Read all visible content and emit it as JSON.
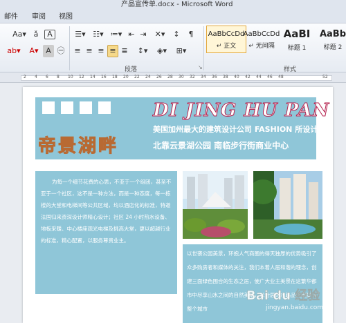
{
  "window": {
    "title": "产品宣传单.docx - Microsoft Word"
  },
  "tabs": [
    {
      "label": "邮件"
    },
    {
      "label": "审阅"
    },
    {
      "label": "视图"
    }
  ],
  "ribbon": {
    "font_size_grow": "Aa",
    "font_color_label": "A",
    "paragraph_group": "段落",
    "styles_group": "样式",
    "styles": [
      {
        "sample": "AaBbCcDd",
        "name": "正文",
        "active": true
      },
      {
        "sample": "AaBbCcDd",
        "name": "无间隔",
        "active": false
      },
      {
        "sample": "AaBI",
        "name": "标题 1",
        "active": false
      },
      {
        "sample": "AaBb",
        "name": "标题 2",
        "active": false
      }
    ]
  },
  "ruler": {
    "numbers": [
      "2",
      "4",
      "6",
      "8",
      "10",
      "12",
      "14",
      "16",
      "18",
      "20",
      "22",
      "24",
      "26",
      "28",
      "30",
      "32",
      "34",
      "36",
      "38",
      "40",
      "42",
      "44",
      "46",
      "48",
      "52"
    ]
  },
  "document": {
    "banner_title": "DI JING HU PAN",
    "banner_cn": "帝景湖畔",
    "banner_line1": "美国加州最大的建筑设计公司 FASHION 所设计",
    "banner_line2": "北靠云景湖公园  南临步行街商业中心",
    "text_block_1": "为每一个细节花费的心思，不亚于一个组团，甚至不亚于一个社区，这不是一种方法，而是一种态度，每一栋楼的大堂和电梯间等公共区域，均以酒店化的标准，特邀法国归来资深设计师精心设计；社区 24 小时热水设备、地板采暖、中心楼座观光电梯及挑高大堂，更以超越行业的标准，精心配置，以服务尊贵业主。",
    "text_block_2": "以世袭公园美景，环抱人气商圈的得天独厚的优势吸引了众多购房者和媒体的关注，我们本着人居和谐的理念，创建三面绿色围合的生态之居，使广大业主美景在这繁华都市中尽享山水之间的自然美景，以怡居的水路品质来提升整个城市"
  },
  "watermark": {
    "text": "Bai du 经验",
    "url": "jingyan.baidu.com"
  },
  "colors": {
    "banner": "#8fc6d8",
    "ribbon_active": "#f6d98a"
  }
}
